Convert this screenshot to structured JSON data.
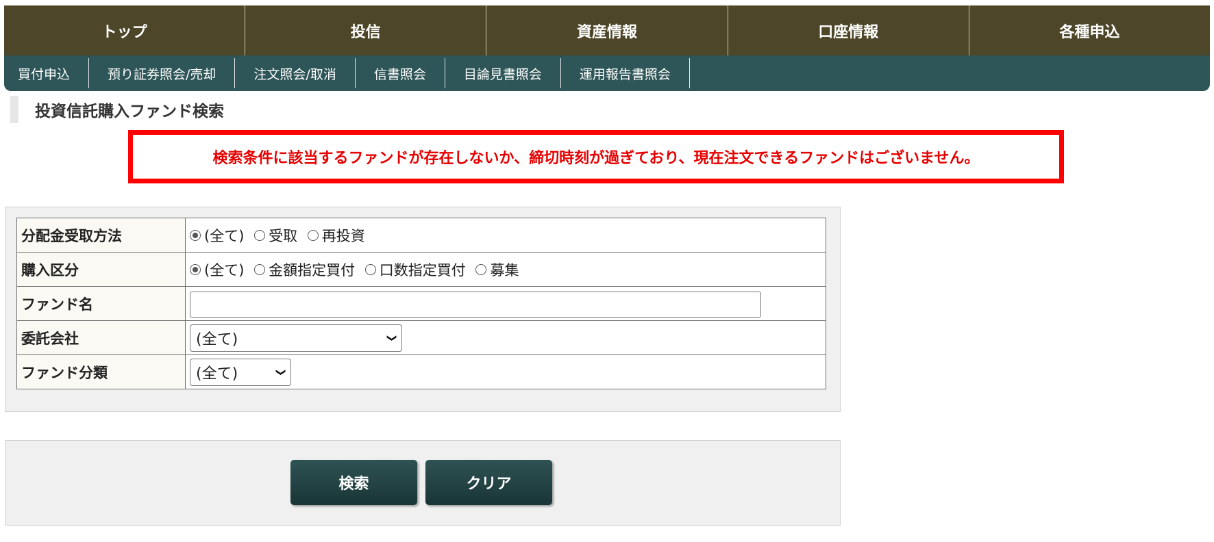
{
  "topnav": {
    "tabs": [
      "トップ",
      "投信",
      "資産情報",
      "口座情報",
      "各種申込"
    ]
  },
  "subnav": {
    "items": [
      "買付申込",
      "預り証券照会/売却",
      "注文照会/取消",
      "信書照会",
      "目論見書照会",
      "運用報告書照会"
    ]
  },
  "page_title": "投資信託購入ファンド検索",
  "error_message": "検索条件に該当するファンドが存在しないか、締切時刻が過ぎており、現在注文できるファンドはございません。",
  "form": {
    "rows": [
      {
        "label": "分配金受取方法",
        "type": "radio",
        "options": [
          "(全て)",
          "受取",
          "再投資"
        ],
        "selected": "(全て)"
      },
      {
        "label": "購入区分",
        "type": "radio",
        "options": [
          "(全て)",
          "金額指定買付",
          "口数指定買付",
          "募集"
        ],
        "selected": "(全て)"
      },
      {
        "label": "ファンド名",
        "type": "text",
        "value": "",
        "placeholder": ""
      },
      {
        "label": "委託会社",
        "type": "select",
        "value": "(全て)"
      },
      {
        "label": "ファンド分類",
        "type": "select",
        "value": "(全て)"
      }
    ]
  },
  "buttons": {
    "search": "検索",
    "clear": "クリア"
  },
  "colors": {
    "topnav": "#4e4628",
    "subnav": "#2e5557",
    "error": "#e60000",
    "button": "#2f5253"
  }
}
